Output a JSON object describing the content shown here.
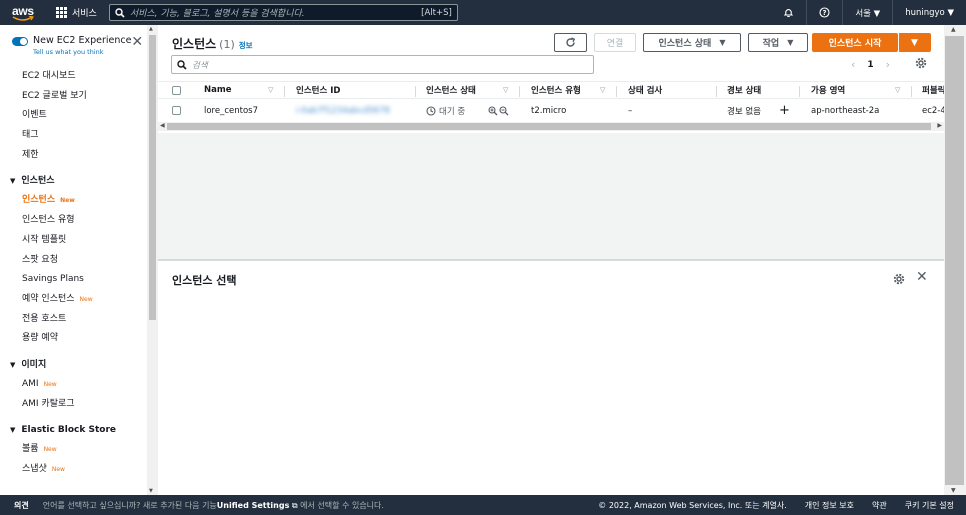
{
  "nav": {
    "logo": "aws",
    "services": "서비스",
    "search_placeholder": "서비스, 기능, 블로그, 설명서 등을 검색합니다.",
    "search_shortcut": "[Alt+S]",
    "region": "서울 ▼",
    "user": "huningyo ▼"
  },
  "sidebar": {
    "toggle_title": "New EC2 Experience",
    "toggle_sub": "Tell us what you think",
    "new_label": "New",
    "top_items": [
      "EC2 대시보드",
      "EC2 글로벌 보기",
      "이벤트",
      "태그",
      "제한"
    ],
    "sections": [
      {
        "title": "인스턴스",
        "items": [
          "인스턴스",
          "인스턴스 유형",
          "시작 템플릿",
          "스팟 요청",
          "Savings Plans",
          "예약 인스턴스",
          "전용 호스트",
          "용량 예약"
        ]
      },
      {
        "title": "이미지",
        "items": [
          "AMI",
          "AMI 카탈로그"
        ]
      },
      {
        "title": "Elastic Block Store",
        "items": [
          "볼륨",
          "스냅샷"
        ]
      }
    ]
  },
  "instances": {
    "title": "인스턴스",
    "count": "(1)",
    "info": "정보",
    "btn_connect": "연결",
    "btn_state": "인스턴스 상태",
    "btn_actions": "작업",
    "btn_launch": "인스턴스 시작",
    "search_placeholder": "검색",
    "page": "1",
    "columns": [
      "Name",
      "인스턴스 ID",
      "인스턴스 상태",
      "인스턴스 유형",
      "상태 검사",
      "경보 상태",
      "가용 영역",
      "퍼블릭"
    ],
    "row": {
      "name": "lore_centos7",
      "id": "i-0ab7f1234abcd5678",
      "state": "대기 중",
      "type": "t2.micro",
      "check": "–",
      "alarm": "경보 없음",
      "az": "ap-northeast-2a",
      "dns": "ec2-4"
    }
  },
  "detail": {
    "title": "인스턴스 선택"
  },
  "footer": {
    "feedback": "의견",
    "msg_pre": "언어를 선택하고 싶으십니까? 새로 추가된 다음 기능",
    "msg_bold": "Unified Settings",
    "msg_post": "에서 선택할 수 있습니다.",
    "copyright": "© 2022, Amazon Web Services, Inc. 또는 계열사.",
    "privacy": "개인 정보 보호",
    "terms": "약관",
    "cookies": "쿠키 기본 설정"
  },
  "colors": {
    "nav_bg": "#232f3e",
    "accent": "#ec7211",
    "link": "#0073bb"
  }
}
